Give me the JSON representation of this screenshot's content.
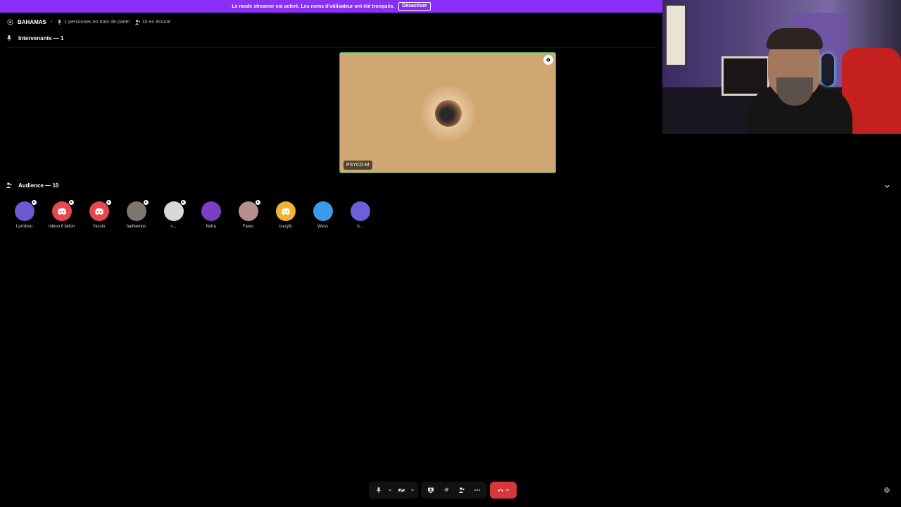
{
  "banner": {
    "text": "Le mode streamer est activé. Les noms d'utilisateur ont été tronqués.",
    "button": "Désactiver"
  },
  "header": {
    "channel": "BAHAMAS",
    "speaking": "1 personnes en train de parler",
    "listening": "10 en écoute"
  },
  "speakers": {
    "label": "Intervenants — 1",
    "tile": {
      "name": "PSYCO-M"
    }
  },
  "audience": {
    "label": "Audience — 10",
    "members": [
      {
        "name": "Larnibou",
        "color": "#6a5acd",
        "badge": true,
        "icon": "avatar"
      },
      {
        "name": "mibon fi bidon",
        "color": "#e5484d",
        "badge": true,
        "icon": "discord"
      },
      {
        "name": "Yassin",
        "color": "#e5484d",
        "badge": true,
        "icon": "discord"
      },
      {
        "name": "haithemos",
        "color": "#7d7570",
        "badge": true,
        "icon": "avatar"
      },
      {
        "name": "c...",
        "color": "#d8d8d8",
        "badge": true,
        "icon": "avatar"
      },
      {
        "name": "Noha",
        "color": "#7b3fc4",
        "badge": false,
        "icon": "avatar"
      },
      {
        "name": "Fares",
        "color": "#b78f8c",
        "badge": true,
        "icon": "avatar"
      },
      {
        "name": "crazyfs",
        "color": "#f0b232",
        "badge": false,
        "icon": "discord"
      },
      {
        "name": "Wess",
        "color": "#3b9be8",
        "badge": false,
        "icon": "avatar"
      },
      {
        "name": "b...",
        "color": "#6b60d8",
        "badge": false,
        "icon": "avatar"
      }
    ]
  },
  "colors": {
    "banner": "#8a2ff5",
    "tile_bg": "#cfa772",
    "speaking_ring": "#3ba55d",
    "hangup": "#da373c"
  }
}
